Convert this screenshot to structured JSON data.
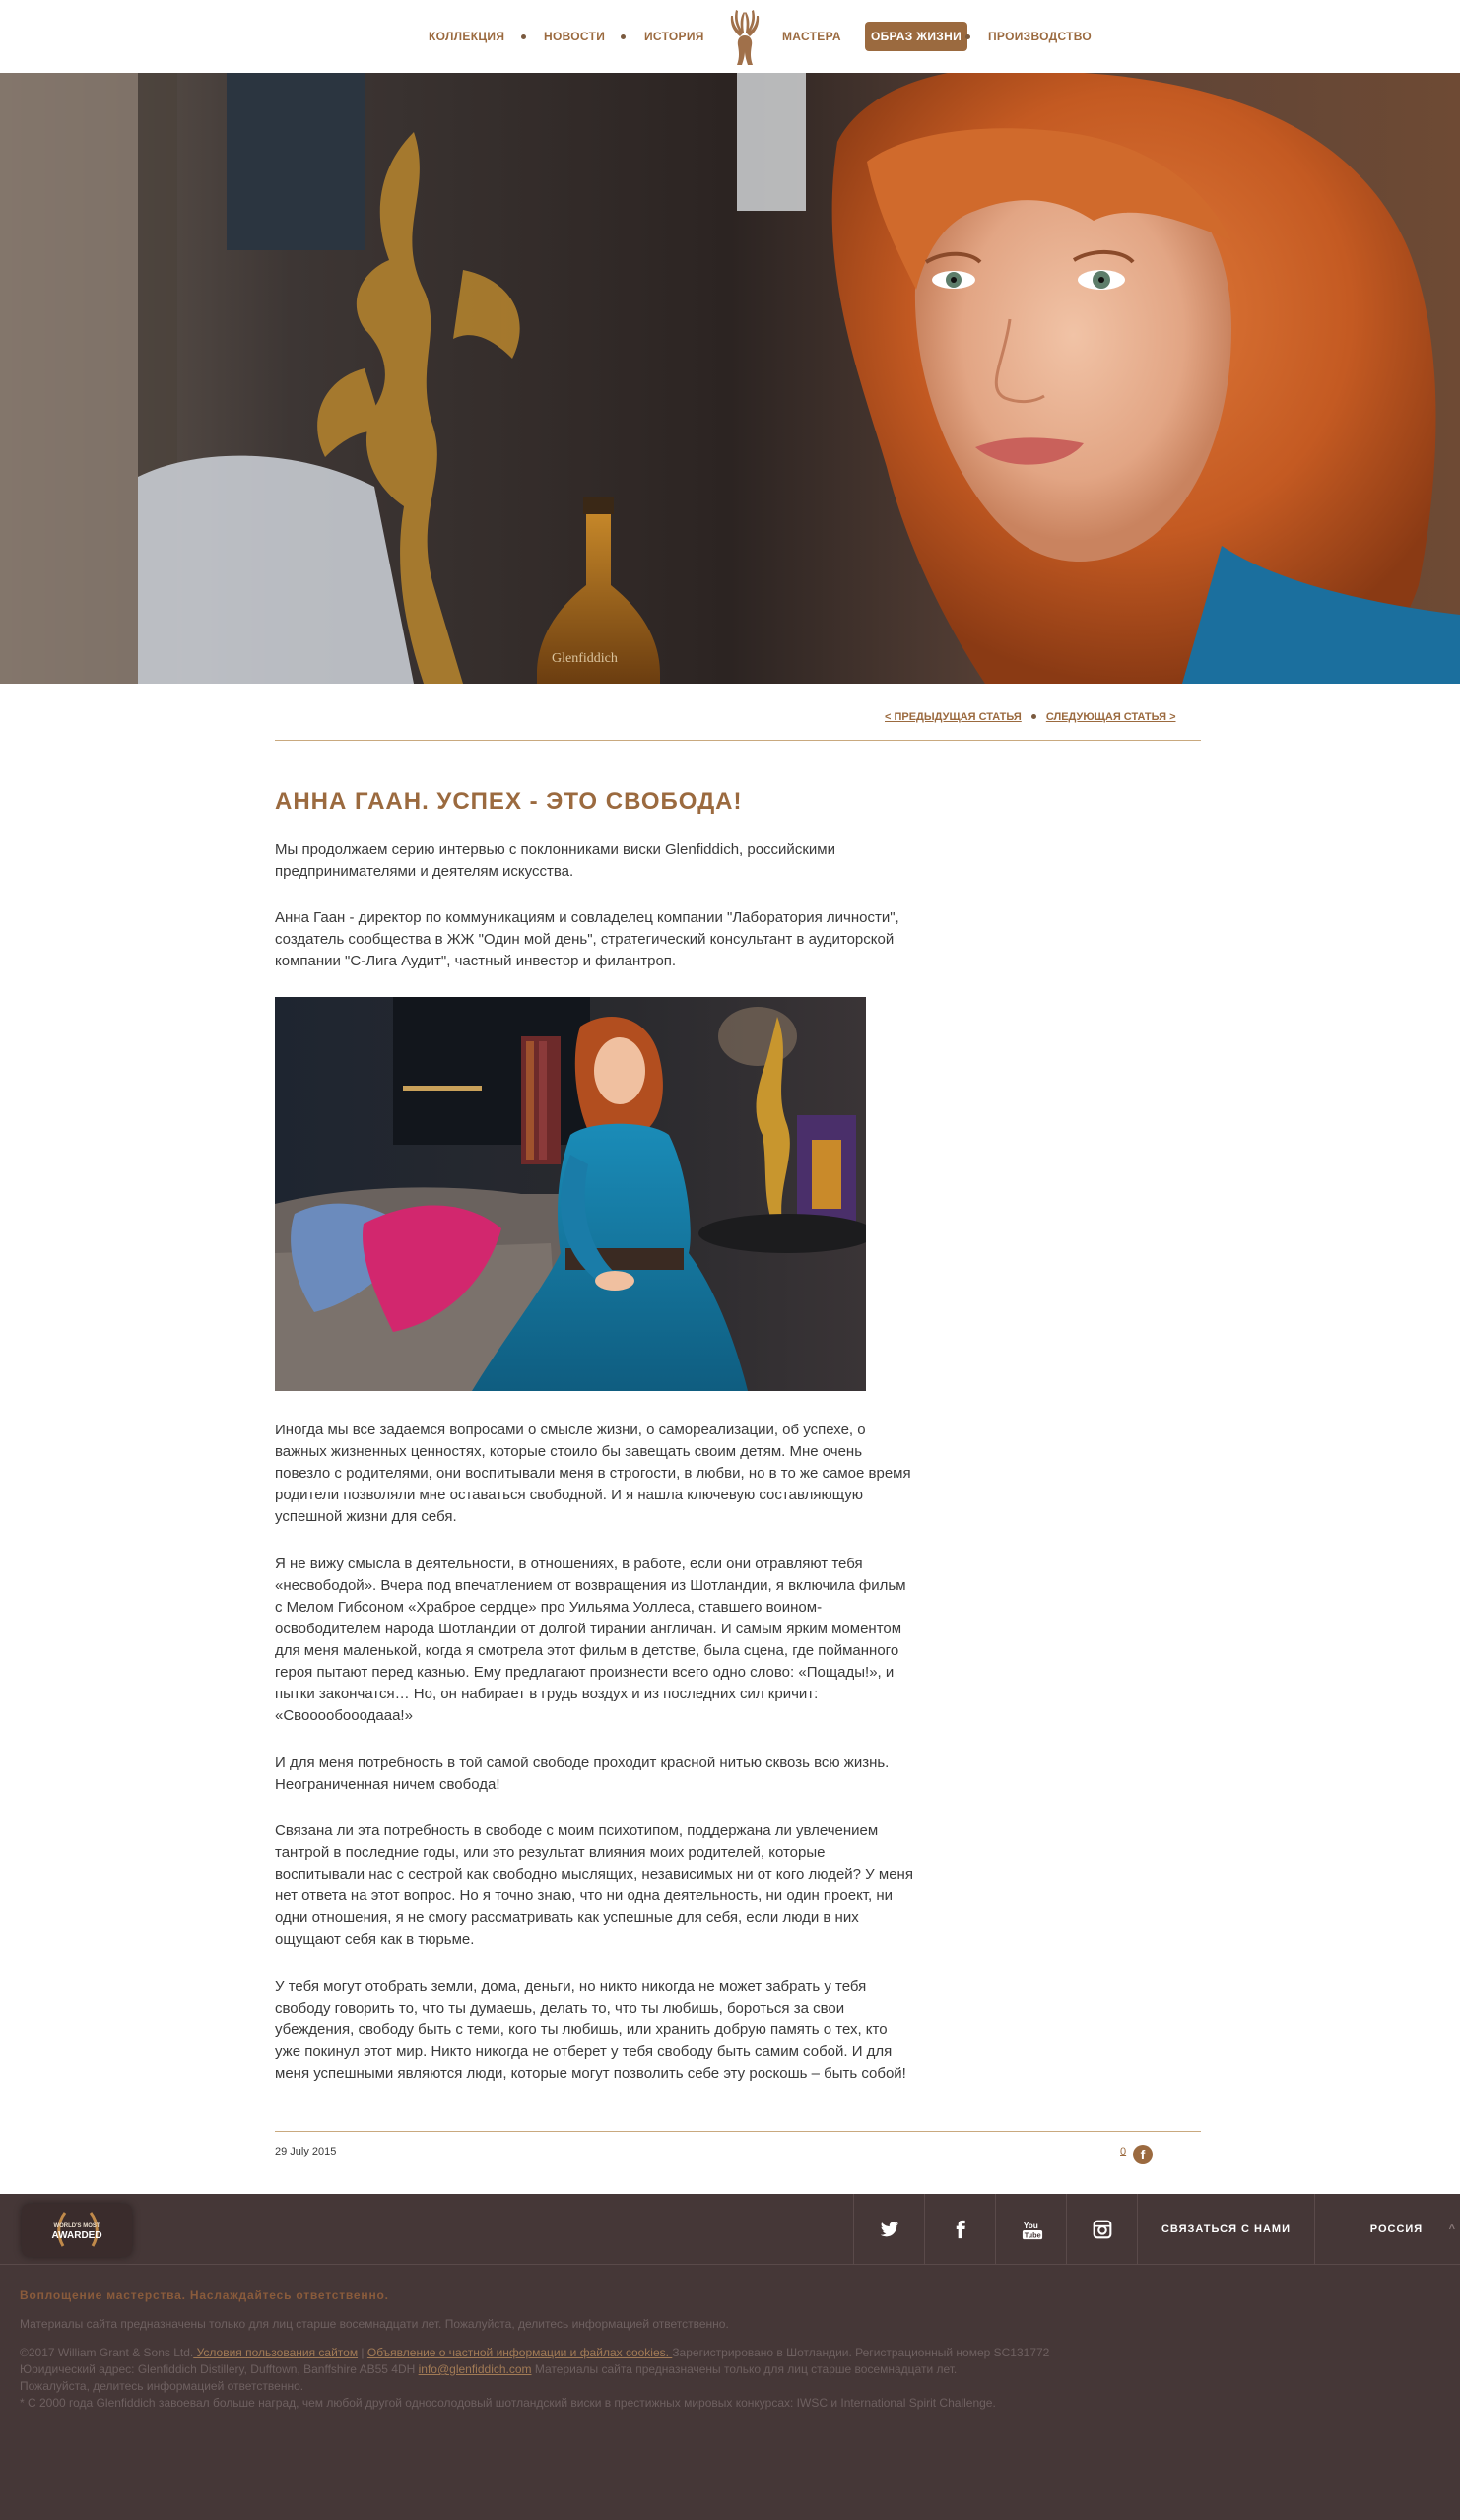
{
  "nav": {
    "items": [
      "КОЛЛЕКЦИЯ",
      "НОВОСТИ",
      "ИСТОРИЯ",
      "МАСТЕРА",
      "ОБРАЗ ЖИЗНИ",
      "ПРОИЗВОДСТВО"
    ],
    "active": "ОБРАЗ ЖИЗНИ",
    "logo_icon": "stag-logo-icon"
  },
  "article_nav": {
    "prev": "< ПРЕДЫДУЩАЯ СТАТЬЯ",
    "next": "СЛЕДУЮЩАЯ СТАТЬЯ >"
  },
  "article": {
    "title": "АННА ГААН. УСПЕХ - ЭТО СВОБОДА!",
    "intro": "Мы продолжаем серию интервью с поклонниками виски Glenfiddich, российскими предпринимателями  и деятелям искусства.",
    "bio": "Анна Гаан - директор по коммуникациям и совладелец компании \"Лаборатория личности\", создатель сообщества в ЖЖ \"Один мой день\", стратегический консультант в аудиторской компании \"С-Лига Аудит\", частный инвестор и филантроп.",
    "paragraphs": [
      "Иногда мы все задаемся вопросами о смысле жизни, о самореализации, об успехе, о важных жизненных ценностях, которые стоило бы завещать своим детям. Мне очень повезло с родителями, они воспитывали меня в строгости, в любви, но в то же самое время родители позволяли мне оставаться свободной. И я нашла ключевую составляющую успешной жизни для себя.",
      "Я не вижу смысла в деятельности, в отношениях, в работе, если они отравляют тебя «несвободой». Вчера под впечатлением от возвращения из Шотландии, я включила фильм с Мелом Гибсоном «Храброе сердце» про Уильяма Уоллеса, ставшего воином-освободителем народа Шотландии от долгой тирании англичан. И самым ярким моментом для меня маленькой, когда я смотрела этот фильм в детстве, была сцена, где пойманного героя пытают перед казнью. Ему предлагают произнести всего одно слово: «Пощады!», и пытки закончатся… Но, он набирает в грудь воздух и из последних сил кричит: «Свооообооодааа!»",
      "И для меня потребность в той самой свободе проходит красной нитью сквозь всю жизнь. Неограниченная ничем свобода!",
      "Связана ли эта потребность в свободе с моим психотипом, поддержана ли увлечением тантрой в последние годы, или это результат влияния моих родителей, которые воспитывали нас с сестрой как свободно мыслящих, независимых ни от кого людей? У меня нет ответа на этот вопрос. Но я точно знаю, что ни одна деятельность, ни один проект, ни одни отношения, я не смогу рассматривать как успешные для себя, если люди в них ощущают себя как в тюрьме.",
      "У тебя могут отобрать земли, дома, деньги, но никто никогда не может забрать у тебя свободу говорить то, что ты думаешь, делать то, что ты любишь, бороться за свои убеждения, свободу быть с теми, кого ты любишь, или хранить добрую память о тех, кто уже покинул этот мир. Никто никогда не отберет у тебя свободу быть самим собой. И для меня успешными являются люди, которые могут позволить себе эту роскошь – быть собой!"
    ],
    "date": "29 July 2015",
    "share_count": "0"
  },
  "footer": {
    "award_line1": "WORLD'S MOST",
    "award_line2": "AWARDED",
    "social": [
      "twitter-icon",
      "facebook-icon",
      "youtube-icon",
      "instagram-icon"
    ],
    "contact": "СВЯЗАТЬСЯ С НАМИ",
    "region": "РОССИЯ",
    "motto": "Воплощение мастерства. Наслаждайтесь ответственно.",
    "disclaimer": "Материалы сайта предназначены только для лиц старше восемнадцати лет. Пожалуйста, делитесь информацией ответственно.",
    "copyright": "©2017 William Grant & Sons Ltd.",
    "terms": " Условия пользования сайтом",
    "divider": " | ",
    "privacy": "Объявление о частной информации и файлах cookies. ",
    "registered": "Зарегистрировано в Шотландии. Регистрационный номер SC131772",
    "address": "Юридический адрес: Glenfiddich Distillery, Dufftown, Banffshire AB55 4DH ",
    "email": "info@glenfiddich.com",
    "address_tail": " Материалы сайта предназначены только для лиц старше восемнадцати лет.",
    "share_resp": "Пожалуйста, делитесь информацией ответственно.",
    "awards_note": "* С 2000 года Glenfiddich завоевал больше наград, чем любой другой односолодовый шотландский виски в престижных мировых конкурсах: IWSC и International Spirit Challenge."
  }
}
